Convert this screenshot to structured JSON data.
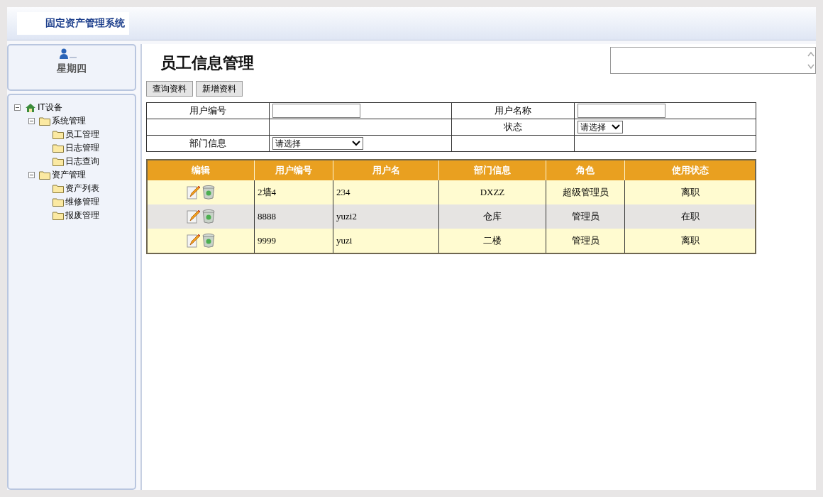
{
  "header": {
    "logo_text": "固定资产管理系统"
  },
  "sidebar": {
    "weekday": "星期四",
    "tree": [
      {
        "label": "IT设备",
        "kind": "root",
        "expanded": true,
        "children": [
          {
            "label": "系统管理",
            "kind": "folder",
            "expanded": true,
            "children": [
              {
                "label": "员工管理",
                "kind": "folder"
              },
              {
                "label": "日志管理",
                "kind": "folder"
              },
              {
                "label": "日志查询",
                "kind": "folder"
              }
            ]
          },
          {
            "label": "资产管理",
            "kind": "folder",
            "expanded": true,
            "children": [
              {
                "label": "资产列表",
                "kind": "folder"
              },
              {
                "label": "维修管理",
                "kind": "folder"
              },
              {
                "label": "报废管理",
                "kind": "folder"
              }
            ]
          }
        ]
      }
    ]
  },
  "page": {
    "title": "员工信息管理",
    "buttons": [
      "查询资料",
      "新增资料"
    ]
  },
  "form": {
    "rows": [
      [
        {
          "kind": "label",
          "text": "用户编号"
        },
        {
          "kind": "input"
        },
        {
          "kind": "label",
          "text": "用户名称"
        },
        {
          "kind": "input"
        }
      ],
      [
        {
          "kind": "empty"
        },
        {
          "kind": "empty"
        },
        {
          "kind": "label",
          "text": "状态"
        },
        {
          "kind": "select",
          "value": "请选择"
        }
      ],
      [
        {
          "kind": "label",
          "text": "部门信息"
        },
        {
          "kind": "select",
          "value": "请选择"
        },
        {
          "kind": "empty"
        },
        {
          "kind": "empty"
        }
      ]
    ]
  },
  "table": {
    "columns": [
      "编辑",
      "用户编号",
      "用户名",
      "部门信息",
      "角色",
      "使用状态"
    ],
    "rows": [
      {
        "user_id": "2墙4",
        "username": "234",
        "department": "DXZZ",
        "role": "超级管理员",
        "status": "离职"
      },
      {
        "user_id": "8888",
        "username": "yuzi2",
        "department": "仓库",
        "role": "管理员",
        "status": "在职"
      },
      {
        "user_id": "9999",
        "username": "yuzi",
        "department": "二楼",
        "role": "管理员",
        "status": "离职"
      }
    ]
  }
}
